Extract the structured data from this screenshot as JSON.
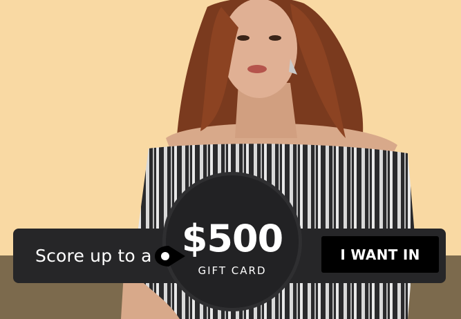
{
  "promo": {
    "lead_text": "Score up to a",
    "amount": "$500",
    "amount_label": "GIFT CARD",
    "cta_label": "I WANT IN"
  },
  "colors": {
    "background": "#f9d9a3",
    "floor": "#7c6a4d",
    "banner": "#262628",
    "cta_background": "#000000",
    "text": "#ffffff"
  },
  "icons": {
    "tag": "gift-tag-icon"
  }
}
